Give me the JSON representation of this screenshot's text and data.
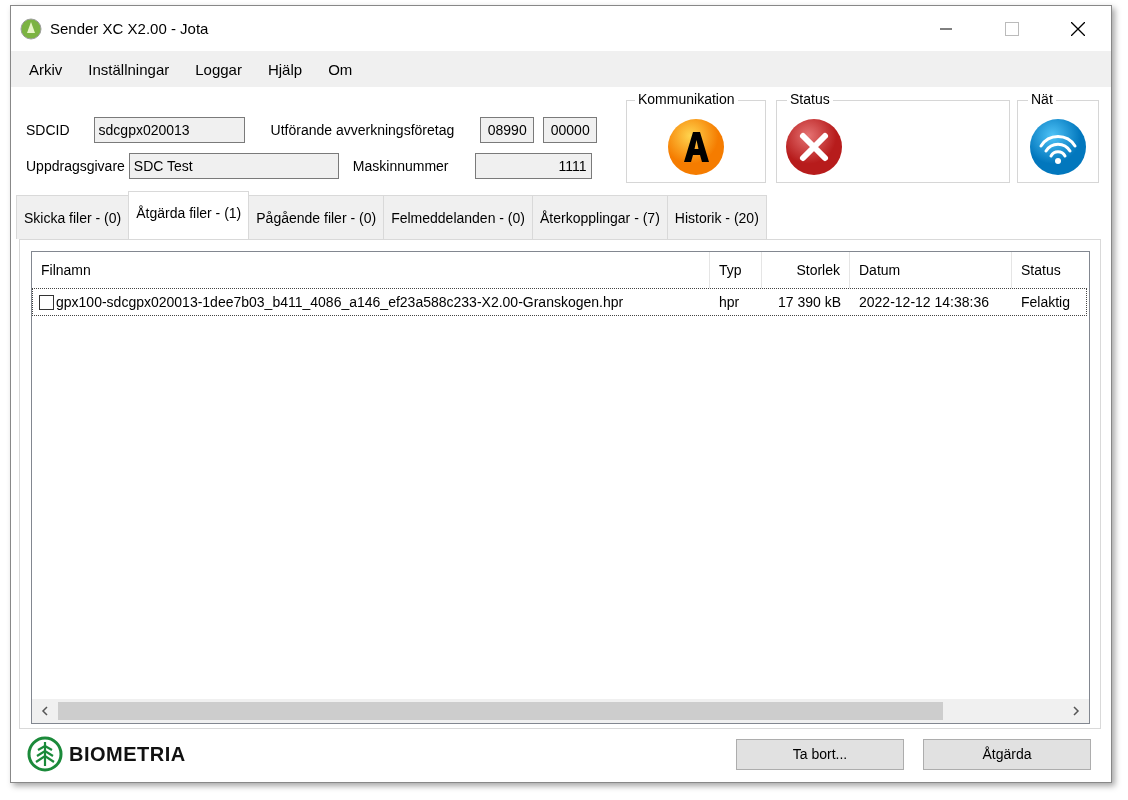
{
  "window": {
    "title": "Sender XC X2.00 - Jota"
  },
  "menu": [
    "Arkiv",
    "Inställningar",
    "Loggar",
    "Hjälp",
    "Om"
  ],
  "header": {
    "sdcid_label": "SDCID",
    "sdcid": "sdcgpx020013",
    "client_label": "Uppdragsgivare",
    "client": "SDC Test",
    "company_label": "Utförande avverkningsföretag",
    "company_codes": [
      "08990",
      "00000"
    ],
    "machine_label": "Maskinnummer",
    "machine": "1111"
  },
  "indicators": [
    {
      "kind": "communication",
      "title": "Kommunikation"
    },
    {
      "kind": "status",
      "title": "Status"
    },
    {
      "kind": "network",
      "title": "Nät"
    }
  ],
  "tabs": [
    {
      "label": "Skicka filer - (0)",
      "selected": false
    },
    {
      "label": "Åtgärda filer - (1)",
      "selected": true
    },
    {
      "label": "Pågående filer - (0)",
      "selected": false
    },
    {
      "label": "Felmeddelanden - (0)",
      "selected": false
    },
    {
      "label": "Återkopplingar - (7)",
      "selected": false
    },
    {
      "label": "Historik - (20)",
      "selected": false
    }
  ],
  "table": {
    "columns": [
      "Filnamn",
      "Typ",
      "Storlek",
      "Datum",
      "Status"
    ],
    "rows": [
      {
        "checked": false,
        "cells": [
          "gpx100-sdcgpx020013-1dee7b03_b411_4086_a146_ef23a588c233-X2.00-Granskogen.hpr",
          "hpr",
          "17 390 kB",
          "2022-12-12 14:38:36",
          "Felaktig"
        ]
      }
    ]
  },
  "logo": "BIOMETRIA",
  "buttons": [
    "Ta bort...",
    "Åtgärda"
  ]
}
